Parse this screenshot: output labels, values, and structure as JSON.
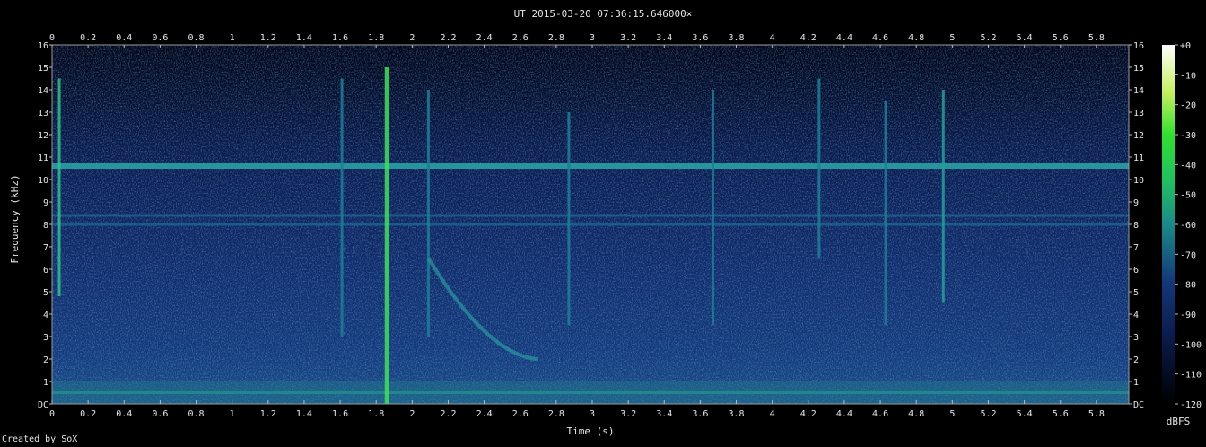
{
  "chart_data": {
    "type": "heatmap",
    "title": "UT 2015-03-20 07:36:15.646000×",
    "xlabel": "Time (s)",
    "ylabel": "Frequency (kHz)",
    "xlim": [
      0,
      5.98
    ],
    "ylim": [
      0,
      16
    ],
    "x_ticks": [
      "0",
      "0.2",
      "0.4",
      "0.6",
      "0.8",
      "1",
      "1.2",
      "1.4",
      "1.6",
      "1.8",
      "2",
      "2.2",
      "2.4",
      "2.6",
      "2.8",
      "3",
      "3.2",
      "3.4",
      "3.6",
      "3.8",
      "4",
      "4.2",
      "4.4",
      "4.6",
      "4.8",
      "5",
      "5.2",
      "5.4",
      "5.6",
      "5.8"
    ],
    "y_ticks": [
      "DC",
      "1",
      "2",
      "3",
      "4",
      "5",
      "6",
      "7",
      "8",
      "9",
      "10",
      "11",
      "12",
      "13",
      "14",
      "15",
      "16"
    ],
    "colorbar": {
      "label": "dBFS",
      "ticks": [
        "+0",
        "-10",
        "-20",
        "-30",
        "-40",
        "-50",
        "-60",
        "-70",
        "-80",
        "-90",
        "-100",
        "-110",
        "-120"
      ],
      "range": [
        -120,
        0
      ]
    },
    "features": {
      "tones_khz": [
        10.6,
        8.4,
        8.0,
        0.5
      ],
      "vertical_events": [
        {
          "t": 0.04,
          "f_lo": 4.8,
          "f_hi": 14.5,
          "level": -70
        },
        {
          "t": 1.61,
          "f_lo": 3.0,
          "f_hi": 14.5,
          "level": -85
        },
        {
          "t": 1.86,
          "f_lo": 0.0,
          "f_hi": 15.0,
          "level": -55
        },
        {
          "t": 2.09,
          "f_lo": 3.0,
          "f_hi": 14.0,
          "level": -90
        },
        {
          "t": 2.87,
          "f_lo": 3.5,
          "f_hi": 13.0,
          "level": -88
        },
        {
          "t": 3.67,
          "f_lo": 3.5,
          "f_hi": 14.0,
          "level": -90
        },
        {
          "t": 4.26,
          "f_lo": 6.5,
          "f_hi": 14.5,
          "level": -85
        },
        {
          "t": 4.63,
          "f_lo": 3.5,
          "f_hi": 13.5,
          "level": -88
        },
        {
          "t": 4.95,
          "f_lo": 4.5,
          "f_hi": 14.0,
          "level": -78
        }
      ],
      "sweep": {
        "t_start": 2.09,
        "f_start": 6.5,
        "t_end": 2.7,
        "f_end": 2.0
      }
    }
  },
  "footer": {
    "credit": "Created by SoX"
  }
}
